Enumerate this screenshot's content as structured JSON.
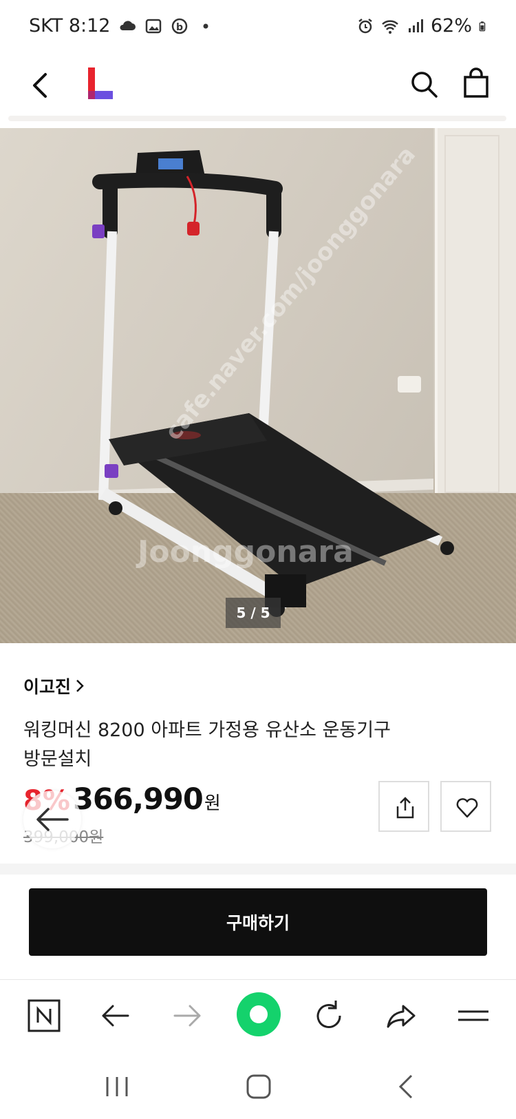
{
  "status_bar": {
    "carrier_time": "SKT 8:12",
    "battery": "62%"
  },
  "product": {
    "image_counter": "5 / 5",
    "brand": "이고진",
    "title": "워킹머신 8200 아파트 가정용 유산소 운동기구 방문설치",
    "discount": "8%",
    "price": "366,990",
    "price_unit": "원",
    "original_price": "399,000원"
  },
  "actions": {
    "buy_label": "구매하기"
  },
  "watermarks": {
    "site": "cafe.naver.com/joonggonara",
    "brand": "Joonggonara"
  },
  "colors": {
    "accent_red": "#e8242e",
    "logo_red": "#e8242e",
    "logo_purple": "#6b4fe0",
    "naver_green": "#14d26c",
    "buy_button": "#0f0f0f"
  },
  "icons": {
    "header": [
      "back-arrow-icon",
      "lotte-logo",
      "search-icon",
      "shopping-bag-icon"
    ],
    "product": [
      "share-icon",
      "heart-icon"
    ],
    "browser": [
      "naver-home-icon",
      "back-arrow-icon",
      "forward-arrow-icon",
      "naver-green-dot-icon",
      "reload-icon",
      "share-forward-icon",
      "menu-icon"
    ],
    "android": [
      "recent-apps-icon",
      "home-icon",
      "nav-back-icon"
    ]
  }
}
